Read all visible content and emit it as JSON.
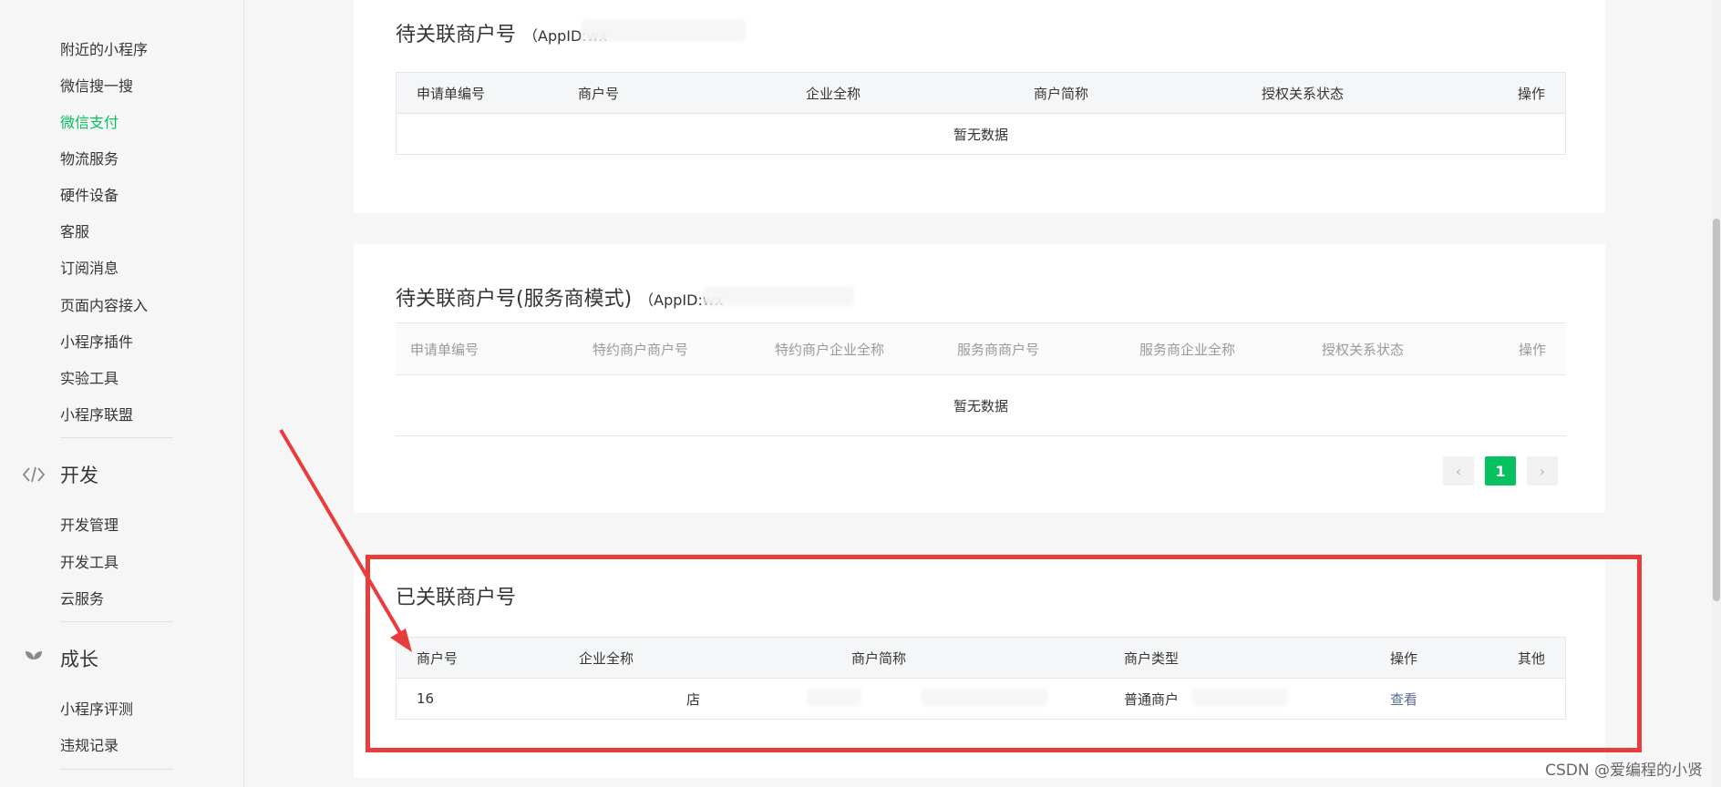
{
  "sidebar": {
    "items": [
      {
        "label": "附近的小程序",
        "active": false
      },
      {
        "label": "微信搜一搜",
        "active": false
      },
      {
        "label": "微信支付",
        "active": true
      },
      {
        "label": "物流服务",
        "active": false
      },
      {
        "label": "硬件设备",
        "active": false
      },
      {
        "label": "客服",
        "active": false
      },
      {
        "label": "订阅消息",
        "active": false
      },
      {
        "label": "页面内容接入",
        "active": false
      },
      {
        "label": "小程序插件",
        "active": false
      },
      {
        "label": "实验工具",
        "active": false
      },
      {
        "label": "小程序联盟",
        "active": false
      }
    ],
    "sections": {
      "develop": {
        "label": "开发",
        "icon": "code-icon",
        "items": [
          {
            "label": "开发管理"
          },
          {
            "label": "开发工具"
          },
          {
            "label": "云服务"
          }
        ]
      },
      "growth": {
        "label": "成长",
        "icon": "sprout-icon",
        "items": [
          {
            "label": "小程序评测"
          },
          {
            "label": "违规记录"
          }
        ]
      }
    }
  },
  "panel1": {
    "title": "待关联商户号",
    "appid": "（AppID:wx",
    "headers": [
      "申请单编号",
      "商户号",
      "企业全称",
      "商户简称",
      "授权关系状态",
      "操作"
    ],
    "empty_text": "暂无数据"
  },
  "panel2": {
    "title": "待关联商户号(服务商模式)",
    "appid": "（AppID:wx",
    "headers": [
      "申请单编号",
      "特约商户商户号",
      "特约商户企业全称",
      "服务商商户号",
      "服务商企业全称",
      "授权关系状态",
      "操作"
    ],
    "empty_text": "暂无数据",
    "pagination": {
      "prev": "‹",
      "current": "1",
      "next": "›"
    }
  },
  "panel3": {
    "title": "已关联商户号",
    "headers": [
      "商户号",
      "企业全称",
      "商户简称",
      "商户类型",
      "操作",
      "其他"
    ],
    "rows": [
      {
        "merchant_id": "16",
        "company": "店",
        "short_name": "",
        "type": "普通商户",
        "action": "查看",
        "other": ""
      }
    ]
  },
  "watermark": "CSDN @爱编程的小贤",
  "colors": {
    "accent": "#07c160",
    "link": "#576b95",
    "highlight": "#e93c3c"
  }
}
